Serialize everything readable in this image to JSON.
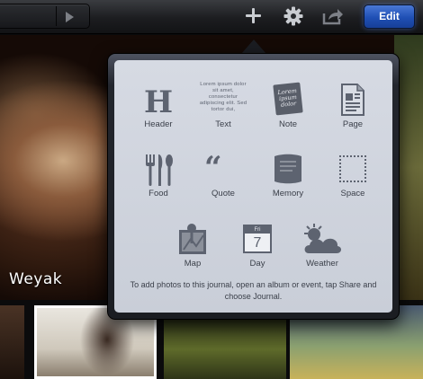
{
  "toolbar": {
    "edit_label": "Edit",
    "icons": [
      "play-icon",
      "plus-icon",
      "gear-icon",
      "share-icon"
    ]
  },
  "photo": {
    "caption": "Weyak"
  },
  "popover": {
    "items": [
      {
        "label": "Header",
        "icon": "header-icon"
      },
      {
        "label": "Text",
        "icon": "text-icon",
        "sample": "Lorem ipsum dolor sit amet, consectetur adipiscing elit. Sed tortor dui,"
      },
      {
        "label": "Note",
        "icon": "note-icon",
        "sample": "Lorem ipsum dolor"
      },
      {
        "label": "Page",
        "icon": "page-icon"
      },
      {
        "label": "Food",
        "icon": "food-icon"
      },
      {
        "label": "Quote",
        "icon": "quote-icon"
      },
      {
        "label": "Memory",
        "icon": "memory-icon"
      },
      {
        "label": "Space",
        "icon": "space-icon"
      },
      {
        "label": "Map",
        "icon": "map-icon"
      },
      {
        "label": "Day",
        "icon": "day-icon",
        "calendar_day_name": "Fri",
        "calendar_date": "7"
      },
      {
        "label": "Weather",
        "icon": "weather-icon"
      }
    ],
    "hint": "To add photos to this journal, open an album or event, tap Share and choose Journal."
  }
}
